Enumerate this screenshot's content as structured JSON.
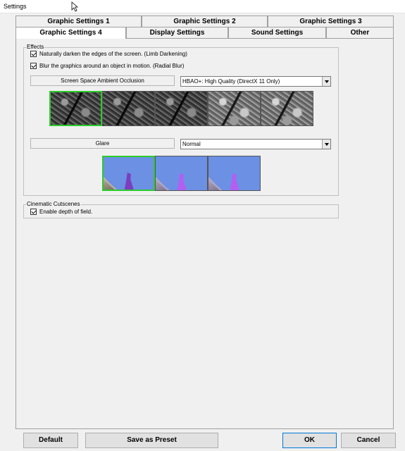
{
  "window": {
    "title": "Settings"
  },
  "tabs_row1": [
    "Graphic Settings 1",
    "Graphic Settings 2",
    "Graphic Settings 3"
  ],
  "tabs_row2": [
    "Graphic Settings 4",
    "Display Settings",
    "Sound Settings",
    "Other"
  ],
  "active_tab": "Graphic Settings 4",
  "effects": {
    "legend": "Effects",
    "limb_darkening": {
      "label": "Naturally darken the edges of the screen. (Limb Darkening)",
      "checked": true
    },
    "radial_blur": {
      "label": "Blur the graphics around an object in motion. (Radial Blur)",
      "checked": true
    },
    "ssao": {
      "label": "Screen Space Ambient Occlusion",
      "value": "HBAO+: High Quality (DirectX 11 Only)",
      "selected_thumb": 0
    },
    "glare": {
      "label": "Glare",
      "value": "Normal",
      "selected_thumb": 0
    }
  },
  "cutscenes": {
    "legend": "Cinematic Cutscenes",
    "dof": {
      "label": "Enable depth of field.",
      "checked": true
    }
  },
  "buttons": {
    "default": "Default",
    "save_preset": "Save as Preset",
    "ok": "OK",
    "cancel": "Cancel"
  },
  "colors": {
    "selected_border": "#2ccc2c",
    "ok_border": "#0078d7"
  }
}
